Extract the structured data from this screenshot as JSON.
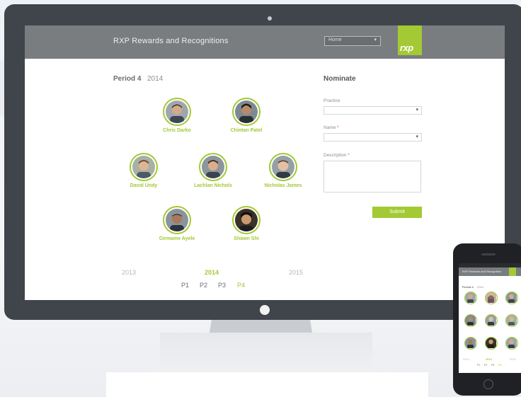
{
  "header": {
    "app_title": "RXP Rewards and Recognitions",
    "nav_select_value": "Home",
    "logo_text": "rxp"
  },
  "period": {
    "label": "Period 4",
    "year": "2014"
  },
  "nominees": [
    {
      "name": "Chris Darko"
    },
    {
      "name": "Chintan Patel"
    },
    {
      "name": "David Undy"
    },
    {
      "name": "Lachlan Nichols"
    },
    {
      "name": "Nicholas James"
    },
    {
      "name": "Girmame Ayele"
    },
    {
      "name": "Shawn Shi"
    }
  ],
  "form": {
    "title": "Nominate",
    "practice_label": "Practice",
    "name_label": "Name",
    "description_label": "Description",
    "required_marker": "*",
    "submit_label": "Submit"
  },
  "timeline": {
    "years": [
      {
        "label": "2013",
        "active": false
      },
      {
        "label": "2014",
        "active": true
      },
      {
        "label": "2015",
        "active": false
      }
    ],
    "periods": [
      {
        "label": "P1",
        "active": false
      },
      {
        "label": "P2",
        "active": false
      },
      {
        "label": "P3",
        "active": false
      },
      {
        "label": "P4",
        "active": true
      }
    ]
  },
  "phone": {
    "title": "RXP Rewards and Recognition",
    "period_label": "Period 4",
    "period_year": "2014",
    "years": [
      "2013",
      "2014",
      "2015"
    ],
    "periods": [
      "P1",
      "P2",
      "P3",
      "P4"
    ]
  },
  "colors": {
    "accent": "#a3c934",
    "header": "#7a7d80",
    "bezel": "#40454b",
    "text_muted": "#6a6d70",
    "required": "#e2574c"
  },
  "icons": [
    "chevron-down-icon",
    "avatar-photo",
    "power-button",
    "camera"
  ]
}
